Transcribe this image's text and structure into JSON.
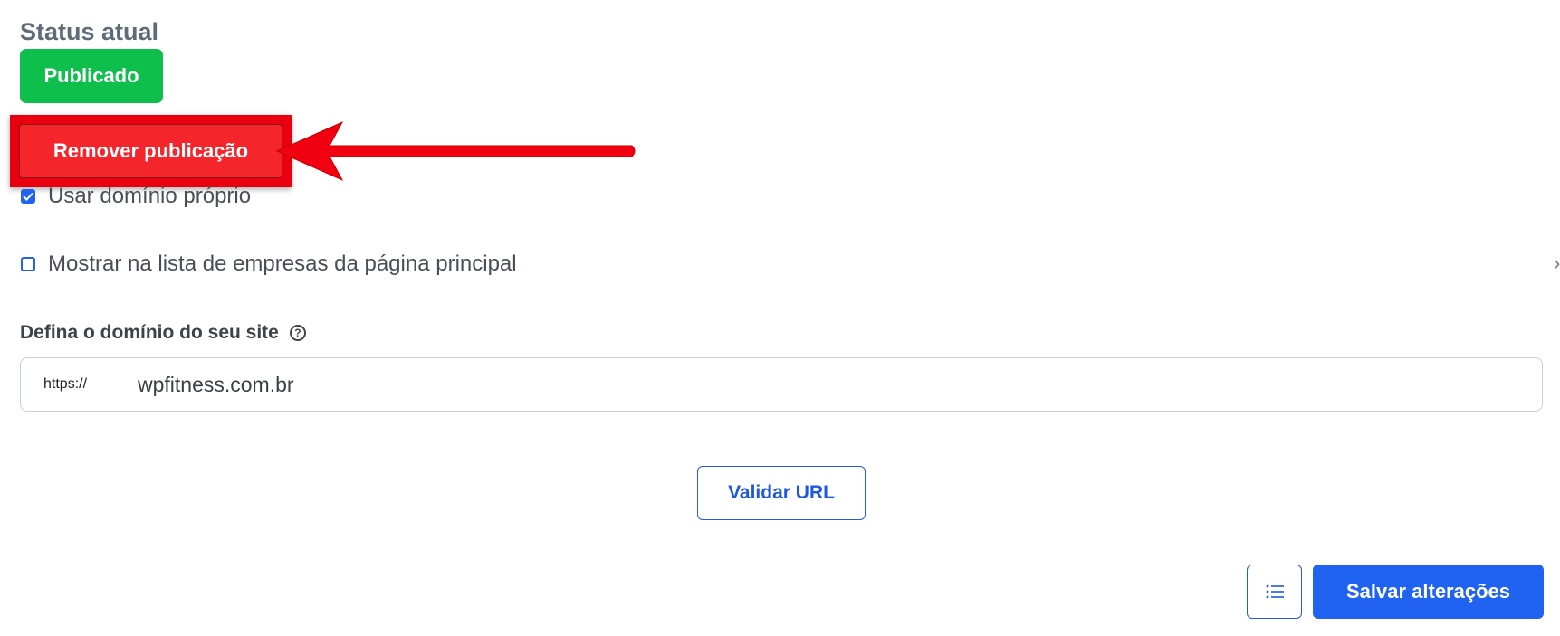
{
  "status": {
    "title": "Status atual",
    "badge": "Publicado",
    "badge_color": "#0fbf4c"
  },
  "actions": {
    "remove_label": "Remover publicação"
  },
  "options": {
    "use_own_domain": {
      "label": "Usar domínio próprio",
      "checked": true
    },
    "show_in_list": {
      "label": "Mostrar na lista de empresas da página principal",
      "checked": false
    }
  },
  "domain": {
    "label": "Defina o domínio do seu site",
    "prefix": "https://",
    "value": "wpfitness.com.br"
  },
  "buttons": {
    "validate": "Validar URL",
    "save": "Salvar alterações"
  },
  "colors": {
    "primary": "#1f63f0",
    "danger": "#f5262b",
    "annotation": "#e8000f"
  }
}
